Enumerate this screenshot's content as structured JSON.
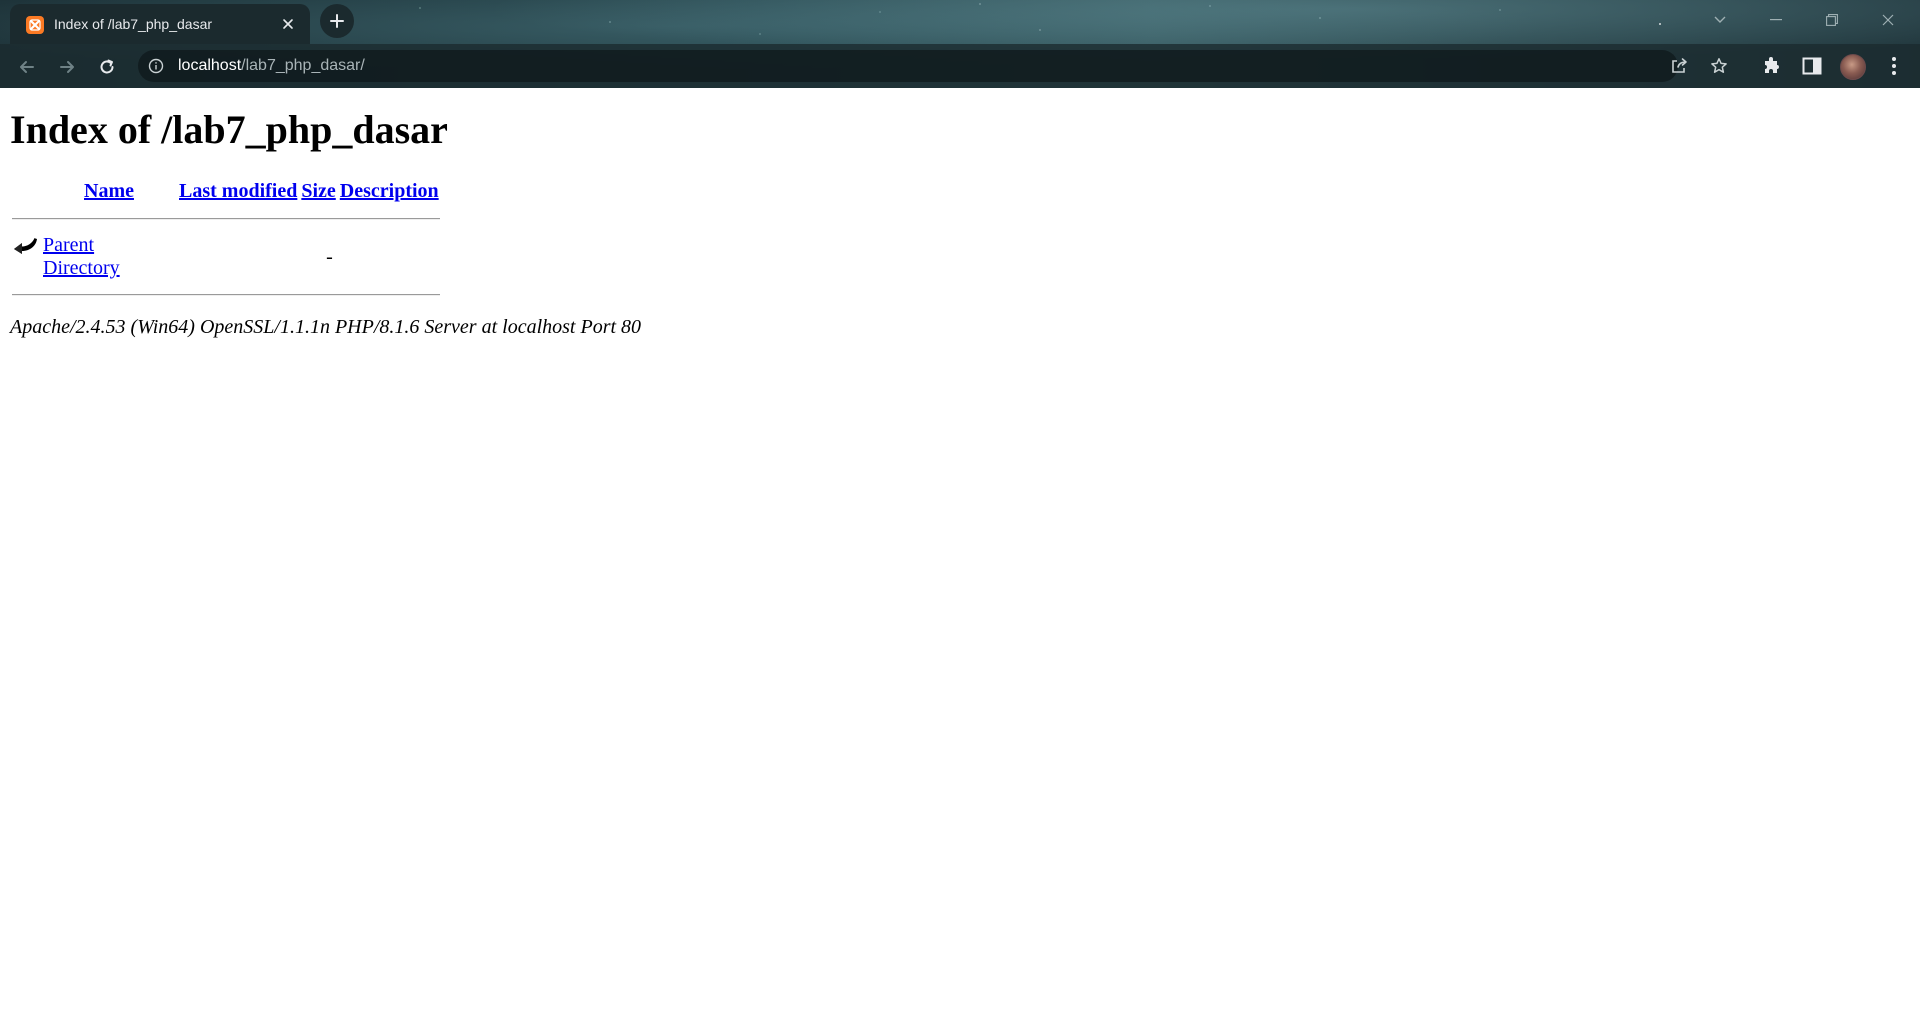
{
  "browser": {
    "tab": {
      "title": "Index of /lab7_php_dasar",
      "favicon": "xampp-icon"
    },
    "address_bar": {
      "host": "localhost",
      "path": "/lab7_php_dasar/"
    },
    "colors": {
      "favicon_orange": "#fb7a24",
      "chrome_dark": "#1b2a2e"
    }
  },
  "page": {
    "heading": "Index of /lab7_php_dasar",
    "columns": {
      "name": "Name",
      "last_modified": "Last modified",
      "size": "Size",
      "description": "Description"
    },
    "rows": [
      {
        "icon": "back-arrow-icon",
        "name": "Parent Directory",
        "last_modified": "",
        "size": "-",
        "description": ""
      }
    ],
    "server_signature": "Apache/2.4.53 (Win64) OpenSSL/1.1.1n PHP/8.1.6 Server at localhost Port 80",
    "colors": {
      "link": "#0000ee"
    }
  }
}
